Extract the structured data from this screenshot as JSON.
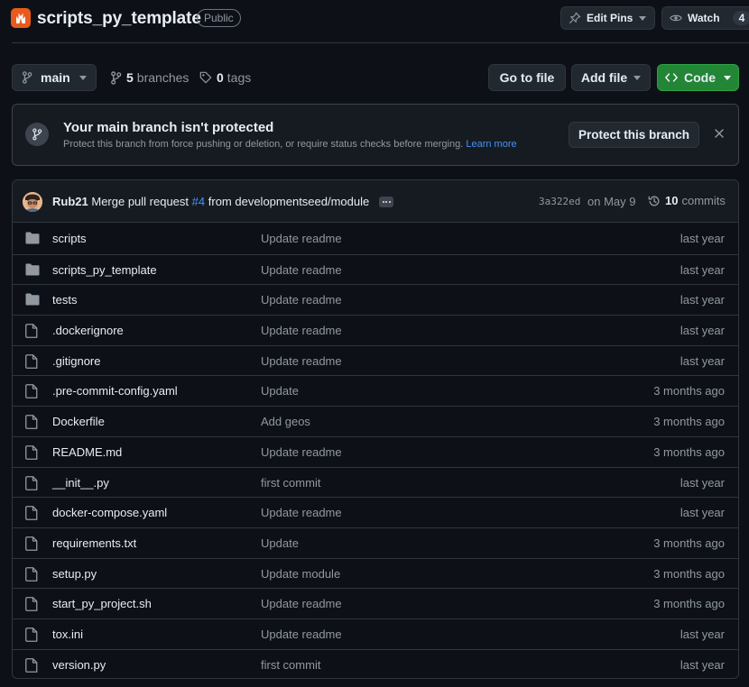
{
  "repo": {
    "name": "scripts_py_template",
    "visibility": "Public",
    "edit_pins_label": "Edit Pins",
    "watch_label": "Watch",
    "watch_count": "4"
  },
  "toolbar": {
    "branch": "main",
    "branches_count": "5",
    "branches_label": "branches",
    "tags_count": "0",
    "tags_label": "tags",
    "go_to_file": "Go to file",
    "add_file": "Add file",
    "code": "Code"
  },
  "flash": {
    "title": "Your main branch isn't protected",
    "body": "Protect this branch from force pushing or deletion, or require status checks before merging.",
    "link": "Learn more",
    "button": "Protect this branch"
  },
  "commit": {
    "author": "Rub21",
    "message_prefix": "Merge pull request",
    "pr": "#4",
    "message_suffix": "from developmentseed/module",
    "hash": "3a322ed",
    "date": "on May 9",
    "count": "10",
    "count_label": "commits"
  },
  "files": [
    {
      "name": "scripts",
      "type": "folder",
      "message": "Update readme",
      "age": "last year"
    },
    {
      "name": "scripts_py_template",
      "type": "folder",
      "message": "Update readme",
      "age": "last year"
    },
    {
      "name": "tests",
      "type": "folder",
      "message": "Update readme",
      "age": "last year"
    },
    {
      "name": ".dockerignore",
      "type": "file",
      "message": "Update readme",
      "age": "last year"
    },
    {
      "name": ".gitignore",
      "type": "file",
      "message": "Update readme",
      "age": "last year"
    },
    {
      "name": ".pre-commit-config.yaml",
      "type": "file",
      "message": "Update",
      "age": "3 months ago"
    },
    {
      "name": "Dockerfile",
      "type": "file",
      "message": "Add geos",
      "age": "3 months ago"
    },
    {
      "name": "README.md",
      "type": "file",
      "message": "Update readme",
      "age": "3 months ago"
    },
    {
      "name": "__init__.py",
      "type": "file",
      "message": "first commit",
      "age": "last year"
    },
    {
      "name": "docker-compose.yaml",
      "type": "file",
      "message": "Update readme",
      "age": "last year"
    },
    {
      "name": "requirements.txt",
      "type": "file",
      "message": "Update",
      "age": "3 months ago"
    },
    {
      "name": "setup.py",
      "type": "file",
      "message": "Update module",
      "age": "3 months ago"
    },
    {
      "name": "start_py_project.sh",
      "type": "file",
      "message": "Update readme",
      "age": "3 months ago"
    },
    {
      "name": "tox.ini",
      "type": "file",
      "message": "Update readme",
      "age": "last year"
    },
    {
      "name": "version.py",
      "type": "file",
      "message": "first commit",
      "age": "last year"
    }
  ],
  "colors": {
    "background": "#0d1117",
    "code_button": "#238636",
    "link": "#4493f8",
    "logo": "#ea5a1c"
  },
  "icons": [
    "repo-logo-icon",
    "pin-icon",
    "eye-icon",
    "branch-icon",
    "tag-icon",
    "code-icon",
    "caret-down-icon",
    "git-branch-icon",
    "close-icon",
    "history-icon",
    "folder-icon",
    "file-icon"
  ]
}
